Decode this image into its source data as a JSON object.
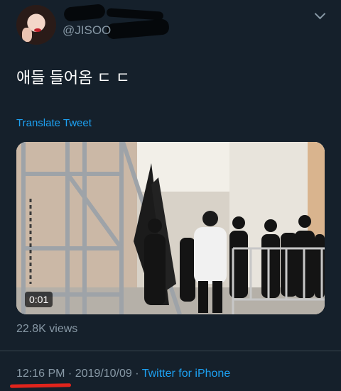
{
  "header": {
    "handle": "@JISOO",
    "menu_icon": "chevron-down-icon"
  },
  "tweet": {
    "text": "애들 들어옴 ㄷ ㄷ",
    "translate_label": "Translate Tweet"
  },
  "video": {
    "duration": "0:01"
  },
  "stats": {
    "views": "22.8K views"
  },
  "footer": {
    "time": "12:16 PM",
    "separator1": " · ",
    "date": "2019/10/09",
    "separator2": " · ",
    "source": "Twitter for iPhone"
  },
  "colors": {
    "background": "#15202b",
    "accent": "#1da1f2",
    "secondary_text": "#8899a6",
    "annotation_red": "#e0241c"
  }
}
